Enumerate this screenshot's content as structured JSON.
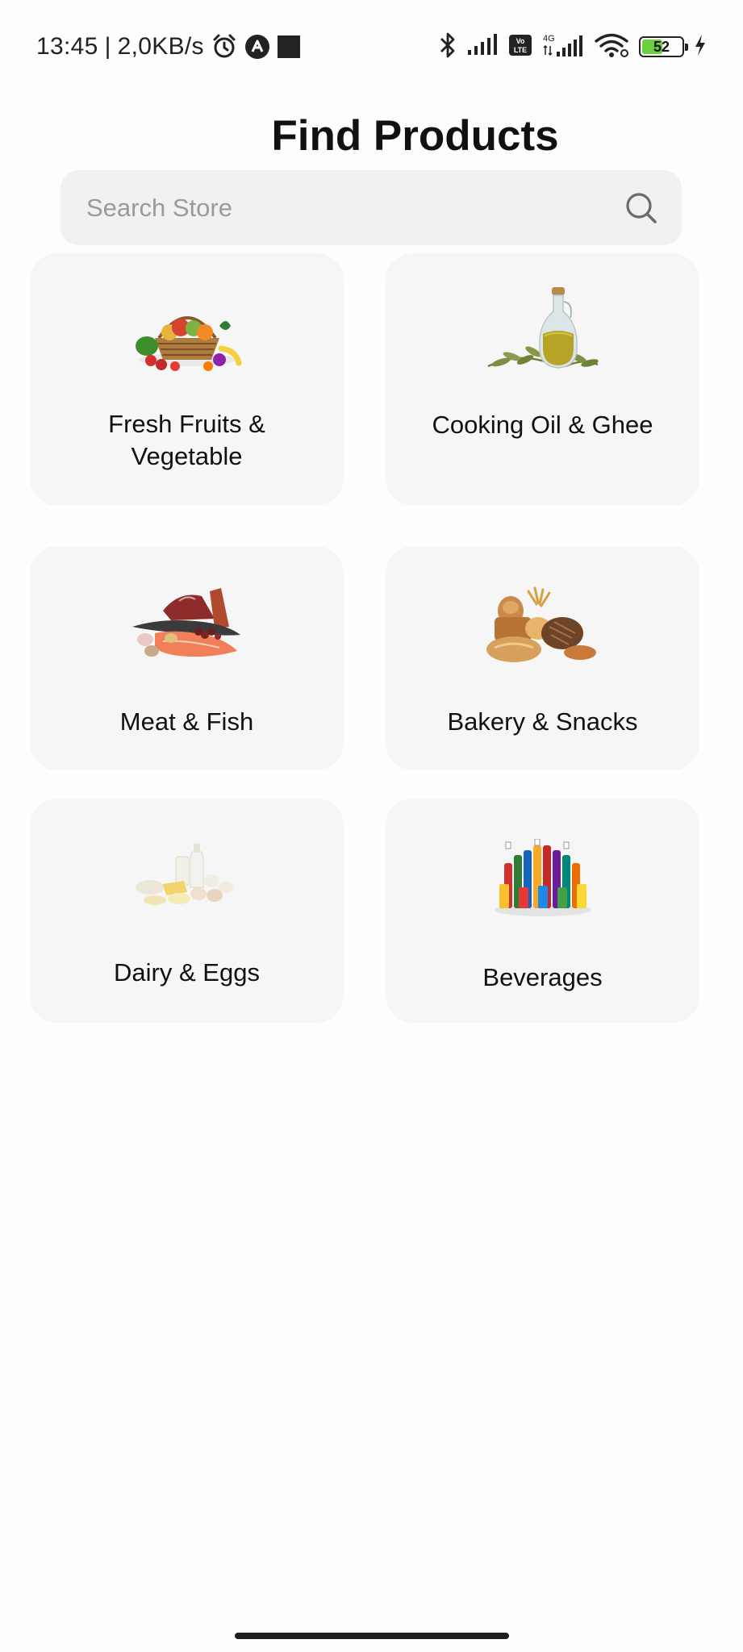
{
  "status_bar": {
    "time": "13:45",
    "separator": "|",
    "network_speed": "2,0KB/s",
    "battery_level": "52",
    "battery_fraction": 0.52,
    "icons_left": [
      "alarm-icon",
      "app-notification-icon",
      "square-notification-icon"
    ],
    "icons_right": [
      "bluetooth-icon",
      "signal-icon",
      "volte-icon",
      "4g-signal-icon",
      "wifi-icon",
      "battery-icon",
      "charging-icon"
    ],
    "lte_badge": "Vo LTE",
    "network_type": "4G"
  },
  "header": {
    "title": "Find Products"
  },
  "search": {
    "placeholder": "Search Store",
    "value": ""
  },
  "categories": [
    {
      "label": "Fresh Fruits &\nVegetable",
      "icon": "fruit-basket-icon"
    },
    {
      "label": "Cooking Oil & Ghee",
      "icon": "olive-oil-bottle-icon"
    },
    {
      "label": "Meat & Fish",
      "icon": "meat-fish-icon"
    },
    {
      "label": "Bakery & Snacks",
      "icon": "bread-icon"
    },
    {
      "label": "Dairy & Eggs",
      "icon": "dairy-eggs-icon"
    },
    {
      "label": "Beverages",
      "icon": "beverage-bottles-icon"
    }
  ],
  "colors": {
    "card_background": "#f6f6f6",
    "search_background": "#f1f1f1",
    "battery_green": "#6bcf3f"
  }
}
